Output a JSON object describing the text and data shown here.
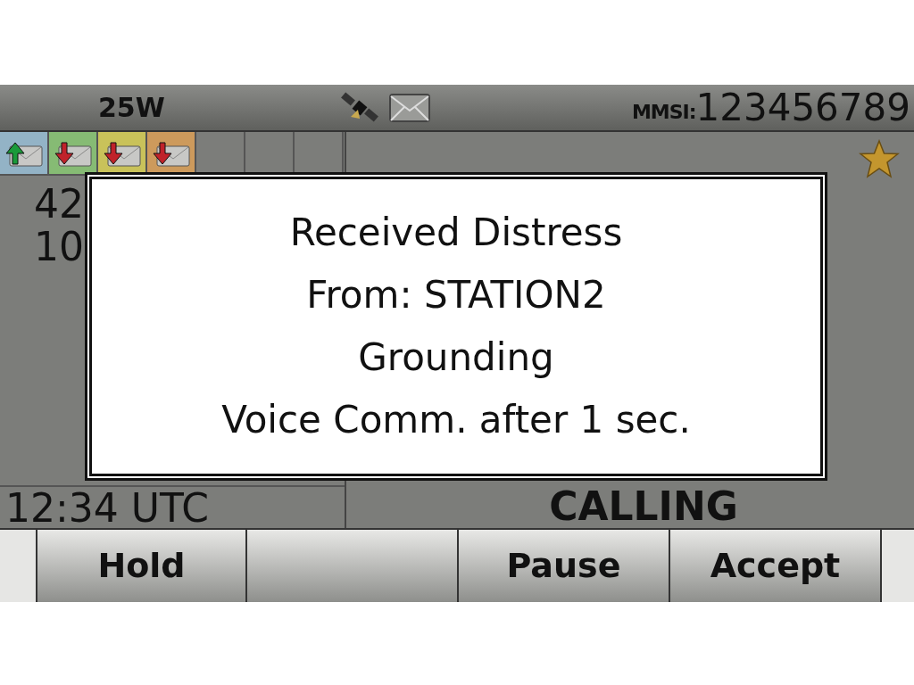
{
  "status_bar": {
    "power": "25W",
    "mmsi_label": "MMSI:",
    "mmsi": "123456789",
    "gps": true,
    "mail": true
  },
  "message_slots": [
    {
      "kind": "sent",
      "color": "#93b3c6"
    },
    {
      "kind": "received",
      "color": "#86bb74"
    },
    {
      "kind": "received",
      "color": "#c9c25a"
    },
    {
      "kind": "received",
      "color": "#cd9a5c"
    },
    {
      "kind": "empty"
    },
    {
      "kind": "empty"
    },
    {
      "kind": "empty"
    }
  ],
  "favorite": true,
  "position": {
    "latitude": "42",
    "longitude": "10"
  },
  "time": "12:34 UTC",
  "call_status": "CALLING",
  "dialog": {
    "lines": [
      "Received Distress",
      "From: STATION2",
      "Grounding",
      "Voice Comm. after 1 sec."
    ]
  },
  "soft_keys": [
    {
      "kind": "key",
      "label": "Hold"
    },
    {
      "kind": "blank"
    },
    {
      "kind": "key",
      "label": "Pause"
    },
    {
      "kind": "key",
      "label": "Accept"
    }
  ]
}
